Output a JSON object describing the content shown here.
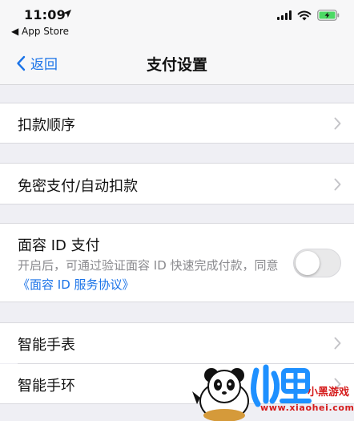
{
  "status_bar": {
    "time": "11:09",
    "back_app": "◀ App Store"
  },
  "nav": {
    "back_label": "返回",
    "title": "支付设置"
  },
  "rows": {
    "deduction_order": "扣款顺序",
    "password_free": "免密支付/自动扣款",
    "face_id": "面容 ID 支付",
    "smartwatch": "智能手表",
    "smartband": "智能手环"
  },
  "face_id": {
    "enabled": false,
    "desc_prefix": "开启后，可通过验证面容 ID 快速完成付款，同意",
    "desc_link": "《面容 ID 服务协议》"
  },
  "watermark": {
    "brand": "小黑游戏",
    "url": "www.xiaohei.com"
  },
  "colors": {
    "accent": "#1a73e8",
    "background": "#efeff4",
    "watermark": "#d51b1b"
  },
  "icons": {
    "location": "location-arrow-icon",
    "signal": "cellular-signal-icon",
    "wifi": "wifi-icon",
    "battery": "battery-charging-icon",
    "back": "chevron-left-icon",
    "disclosure": "chevron-right-icon",
    "mascot": "panda-mascot-icon"
  }
}
